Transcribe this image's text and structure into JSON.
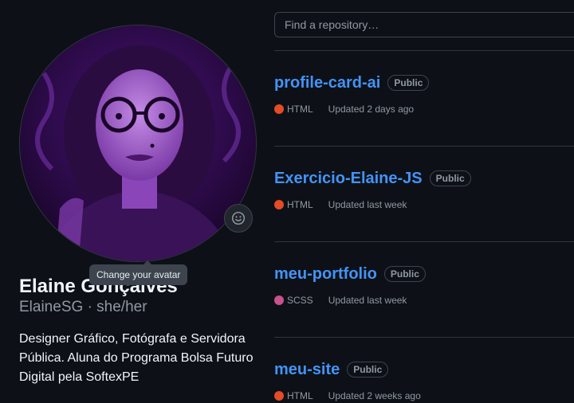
{
  "profile": {
    "name": "Elaine Gonçalves",
    "login": "ElaineSG",
    "separator": "·",
    "pronouns": "she/her",
    "bio": "Designer Gráfico, Fotógrafa e Servidora Pública. Aluna do Programa Bolsa Futuro Digital pela SoftexPE",
    "avatar_tooltip": "Change your avatar",
    "avatar_button_icon": "smiley-icon"
  },
  "search": {
    "placeholder": "Find a repository…"
  },
  "repos": [
    {
      "name": "profile-card-ai",
      "visibility": "Public",
      "language": "HTML",
      "language_color": "#e34c26",
      "updated": "Updated 2 days ago"
    },
    {
      "name": "Exercicio-Elaine-JS",
      "visibility": "Public",
      "language": "HTML",
      "language_color": "#e34c26",
      "updated": "Updated last week"
    },
    {
      "name": "meu-portfolio",
      "visibility": "Public",
      "language": "SCSS",
      "language_color": "#c6538c",
      "updated": "Updated last week"
    },
    {
      "name": "meu-site",
      "visibility": "Public",
      "language": "HTML",
      "language_color": "#e34c26",
      "updated": "Updated 2 weeks ago"
    }
  ],
  "theme": {
    "accent": "#4493f8",
    "background": "#0d1117",
    "border": "#30363d"
  }
}
